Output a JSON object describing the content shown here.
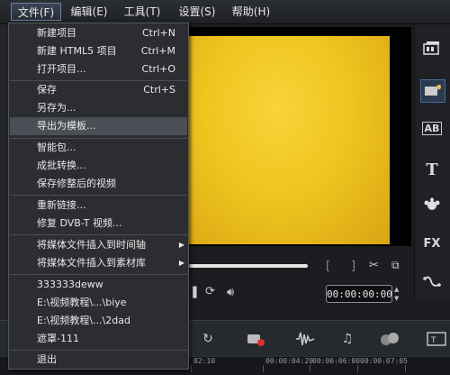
{
  "menubar": [
    {
      "label": "文件(F)",
      "active": true
    },
    {
      "label": "编辑(E)",
      "active": false
    },
    {
      "label": "工具(T)",
      "active": false
    },
    {
      "label": "设置(S)",
      "active": false
    },
    {
      "label": "帮助(H)",
      "active": false
    }
  ],
  "file_menu": {
    "items": [
      {
        "label": "新建项目",
        "shortcut": "Ctrl+N"
      },
      {
        "label": "新建 HTML5 项目",
        "shortcut": "Ctrl+M"
      },
      {
        "label": "打开项目...",
        "shortcut": "Ctrl+O"
      },
      {
        "label": "保存",
        "shortcut": "Ctrl+S"
      },
      {
        "label": "另存为...",
        "shortcut": ""
      },
      {
        "label": "导出为模板...",
        "shortcut": "",
        "highlighted": true
      },
      {
        "label": "智能包...",
        "shortcut": ""
      },
      {
        "label": "成批转换...",
        "shortcut": ""
      },
      {
        "label": "保存修整后的视频",
        "shortcut": ""
      },
      {
        "label": "重新链接...",
        "shortcut": ""
      },
      {
        "label": "修复 DVB-T 视频...",
        "shortcut": ""
      },
      {
        "label": "将媒体文件插入到时间轴",
        "shortcut": "",
        "submenu": true
      },
      {
        "label": "将媒体文件插入到素材库",
        "shortcut": "",
        "submenu": true
      },
      {
        "label": "333333deww",
        "shortcut": ""
      },
      {
        "label": "E:\\视频教程\\...\\biye",
        "shortcut": ""
      },
      {
        "label": "E:\\视频教程\\...\\2dad",
        "shortcut": ""
      },
      {
        "label": "遮罩-111",
        "shortcut": ""
      },
      {
        "label": "退出",
        "shortcut": ""
      }
    ]
  },
  "player": {
    "timecode": "00:00:00:00",
    "bracket_in": "[",
    "bracket_out": "]",
    "progress": 0.0
  },
  "timeline_ruler": [
    "02:10",
    "00:00:04:20",
    "00:00:06:00",
    "00:00:07:05"
  ],
  "right_tools": [
    "media-icon",
    "instant-project-icon",
    "AB",
    "T",
    "graphics-icon",
    "FX",
    "path-icon"
  ],
  "right_tool_labels": {
    "ab": "AB",
    "fx": "FX"
  },
  "colors": {
    "preview_fill": "#efc51f",
    "menu_bg": "#2b2d31",
    "highlight": "#4a4e55"
  }
}
